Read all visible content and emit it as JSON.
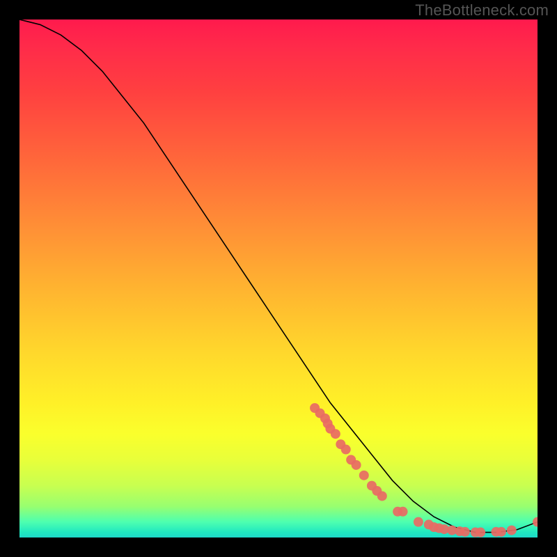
{
  "attribution": "TheBottleneck.com",
  "chart_data": {
    "type": "line",
    "title": "",
    "xlabel": "",
    "ylabel": "",
    "xlim": [
      0,
      100
    ],
    "ylim": [
      0,
      100
    ],
    "curve": {
      "x": [
        0,
        4,
        8,
        12,
        16,
        20,
        24,
        28,
        32,
        36,
        40,
        44,
        48,
        52,
        56,
        60,
        64,
        68,
        72,
        76,
        80,
        84,
        88,
        92,
        96,
        100
      ],
      "y": [
        100,
        99,
        97,
        94,
        90,
        85,
        80,
        74,
        68,
        62,
        56,
        50,
        44,
        38,
        32,
        26,
        21,
        16,
        11,
        7,
        4,
        2,
        1,
        1,
        1.5,
        3
      ]
    },
    "markers": [
      {
        "x": 57,
        "y": 25
      },
      {
        "x": 58,
        "y": 24
      },
      {
        "x": 59,
        "y": 23
      },
      {
        "x": 59.5,
        "y": 22
      },
      {
        "x": 60,
        "y": 21
      },
      {
        "x": 61,
        "y": 20
      },
      {
        "x": 62,
        "y": 18
      },
      {
        "x": 63,
        "y": 17
      },
      {
        "x": 64,
        "y": 15
      },
      {
        "x": 65,
        "y": 14
      },
      {
        "x": 66.5,
        "y": 12
      },
      {
        "x": 68,
        "y": 10
      },
      {
        "x": 69,
        "y": 9
      },
      {
        "x": 70,
        "y": 8
      },
      {
        "x": 73,
        "y": 5
      },
      {
        "x": 74,
        "y": 5
      },
      {
        "x": 77,
        "y": 3
      },
      {
        "x": 79,
        "y": 2.5
      },
      {
        "x": 80,
        "y": 2
      },
      {
        "x": 81,
        "y": 1.8
      },
      {
        "x": 82,
        "y": 1.6
      },
      {
        "x": 83.5,
        "y": 1.4
      },
      {
        "x": 85,
        "y": 1.2
      },
      {
        "x": 86,
        "y": 1.1
      },
      {
        "x": 88,
        "y": 1.0
      },
      {
        "x": 89,
        "y": 1.0
      },
      {
        "x": 92,
        "y": 1.1
      },
      {
        "x": 93,
        "y": 1.1
      },
      {
        "x": 95,
        "y": 1.4
      },
      {
        "x": 100,
        "y": 3.0
      }
    ],
    "marker_radius": 7
  },
  "colors": {
    "background": "#000000",
    "curve": "#000000",
    "marker": "#e86a64",
    "gradient_top": "#ff1a4d",
    "gradient_bottom": "#1ed8c8"
  }
}
